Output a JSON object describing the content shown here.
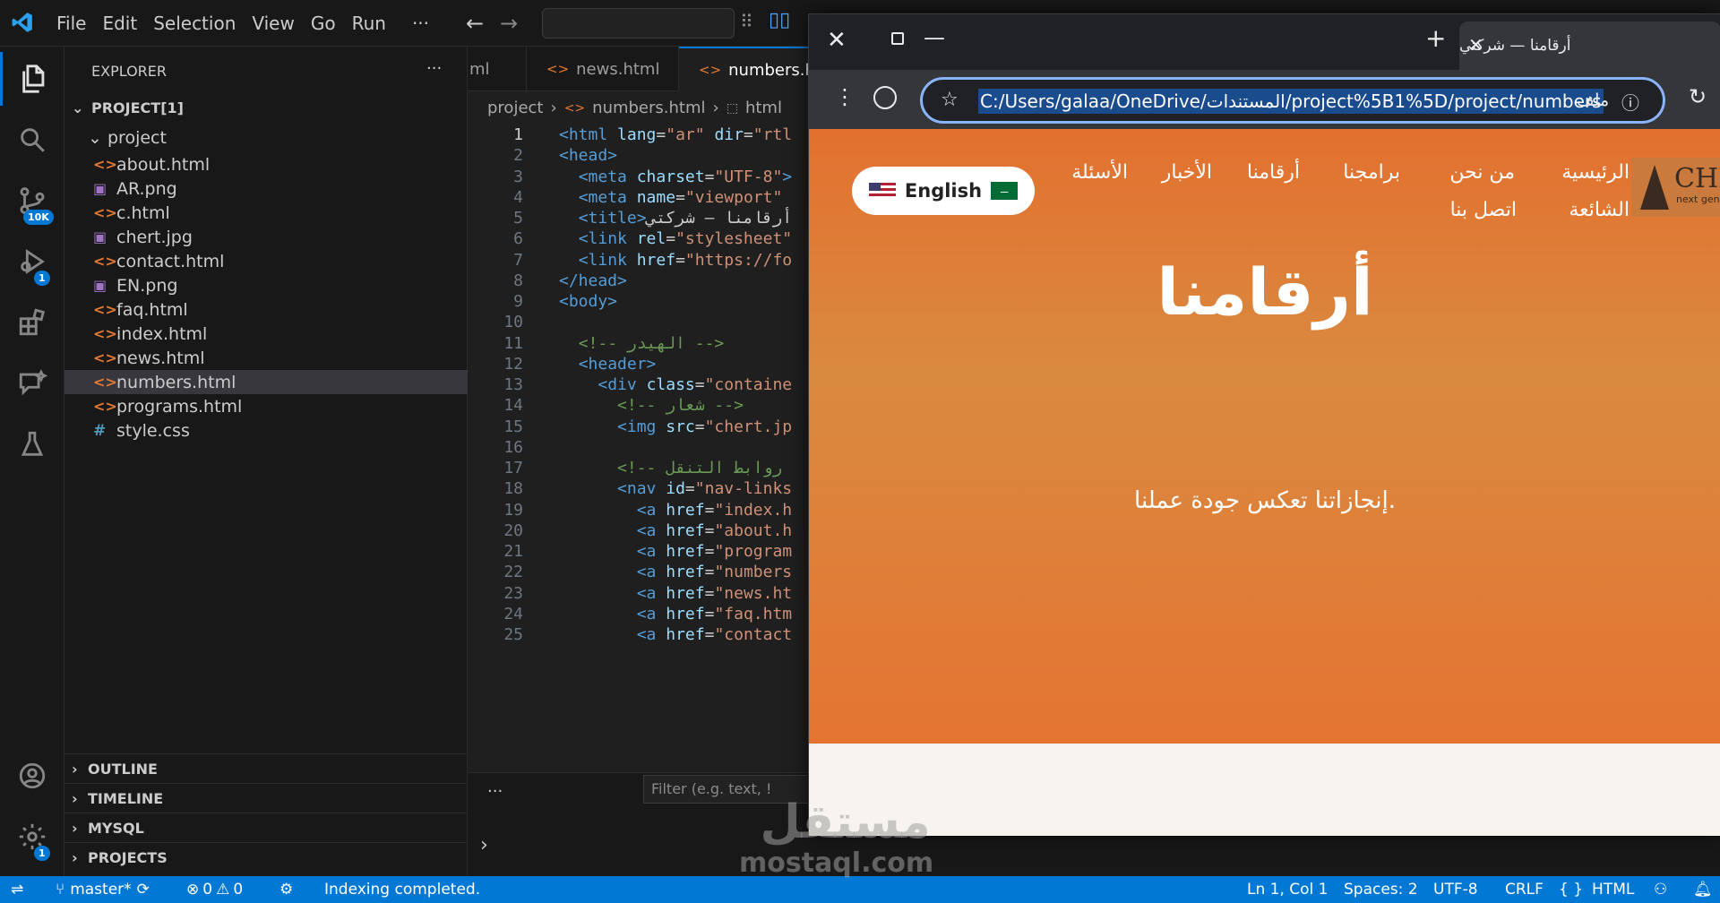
{
  "menu": [
    "File",
    "Edit",
    "Selection",
    "View",
    "Go",
    "Run",
    "···"
  ],
  "activity_badges": {
    "scm": "10K",
    "debug": "1",
    "settings": "1"
  },
  "explorer": {
    "title": "EXPLORER",
    "more": "···",
    "root": "PROJECT[1]",
    "folder": "project",
    "files": [
      {
        "name": "about.html",
        "type": "html"
      },
      {
        "name": "AR.png",
        "type": "img"
      },
      {
        "name": "c.html",
        "type": "html"
      },
      {
        "name": "chert.jpg",
        "type": "img"
      },
      {
        "name": "contact.html",
        "type": "html"
      },
      {
        "name": "EN.png",
        "type": "img"
      },
      {
        "name": "faq.html",
        "type": "html"
      },
      {
        "name": "index.html",
        "type": "html"
      },
      {
        "name": "news.html",
        "type": "html"
      },
      {
        "name": "numbers.html",
        "type": "html",
        "selected": true
      },
      {
        "name": "programs.html",
        "type": "html"
      },
      {
        "name": "style.css",
        "type": "css"
      }
    ],
    "sections": [
      "OUTLINE",
      "TIMELINE",
      "MYSQL",
      "PROJECTS"
    ]
  },
  "tabs": [
    "ml",
    "news.html",
    "numbers.h"
  ],
  "breadcrumb": [
    "project",
    "numbers.html",
    "html"
  ],
  "code_lines": [
    {
      "n": "1",
      "html": "<span class='t'>&lt;html</span> <span class='a'>lang</span>=<span class='s'>\"ar\"</span> <span class='a'>dir</span>=<span class='s'>\"rtl</span>"
    },
    {
      "n": "2",
      "html": "<span class='t'>&lt;head&gt;</span>"
    },
    {
      "n": "3",
      "html": "  <span class='t'>&lt;meta</span> <span class='a'>charset</span>=<span class='s'>\"UTF-8\"</span><span class='t'>&gt;</span>"
    },
    {
      "n": "4",
      "html": "  <span class='t'>&lt;meta</span> <span class='a'>name</span>=<span class='s'>\"viewport\"</span>"
    },
    {
      "n": "5",
      "html": "  <span class='t'>&lt;title&gt;</span>أرقامنا — شركتي"
    },
    {
      "n": "6",
      "html": "  <span class='t'>&lt;link</span> <span class='a'>rel</span>=<span class='s'>\"stylesheet\"</span>"
    },
    {
      "n": "7",
      "html": "  <span class='t'>&lt;link</span> <span class='a'>href</span>=<span class='s'>\"https://fo</span>"
    },
    {
      "n": "8",
      "html": "<span class='t'>&lt;/head&gt;</span>"
    },
    {
      "n": "9",
      "html": "<span class='t'>&lt;body&gt;</span>"
    },
    {
      "n": "10",
      "html": ""
    },
    {
      "n": "11",
      "html": "  <span class='c'>&lt;!-- الهيدر --&gt;</span>"
    },
    {
      "n": "12",
      "html": "  <span class='t'>&lt;header&gt;</span>"
    },
    {
      "n": "13",
      "html": "    <span class='t'>&lt;div</span> <span class='a'>class</span>=<span class='s'>\"containe</span>"
    },
    {
      "n": "14",
      "html": "      <span class='c'>&lt;!-- شعار --&gt;</span>"
    },
    {
      "n": "15",
      "html": "      <span class='t'>&lt;img</span> <span class='a'>src</span>=<span class='s'>\"chert.jp</span>"
    },
    {
      "n": "16",
      "html": ""
    },
    {
      "n": "17",
      "html": "      <span class='c'>&lt;!-- روابط التنقل</span>"
    },
    {
      "n": "18",
      "html": "      <span class='t'>&lt;nav</span> <span class='a'>id</span>=<span class='s'>\"nav-links</span>"
    },
    {
      "n": "19",
      "html": "        <span class='t'>&lt;a</span> <span class='a'>href</span>=<span class='s'>\"index.h</span>"
    },
    {
      "n": "20",
      "html": "        <span class='t'>&lt;a</span> <span class='a'>href</span>=<span class='s'>\"about.h</span>"
    },
    {
      "n": "21",
      "html": "        <span class='t'>&lt;a</span> <span class='a'>href</span>=<span class='s'>\"program</span>"
    },
    {
      "n": "22",
      "html": "        <span class='t'>&lt;a</span> <span class='a'>href</span>=<span class='s'>\"numbers</span>"
    },
    {
      "n": "23",
      "html": "        <span class='t'>&lt;a</span> <span class='a'>href</span>=<span class='s'>\"news.ht</span>"
    },
    {
      "n": "24",
      "html": "        <span class='t'>&lt;a</span> <span class='a'>href</span>=<span class='s'>\"faq.htm</span>"
    },
    {
      "n": "25",
      "html": "        <span class='t'>&lt;a</span> <span class='a'>href</span>=<span class='s'>\"contact</span>"
    }
  ],
  "panel": {
    "more": "···",
    "filter_placeholder": "Filter (e.g. text, !"
  },
  "status": {
    "branch": "master*",
    "errors": "0",
    "warnings": "0",
    "message": "Indexing completed.",
    "position": "Ln 1, Col 1",
    "spaces": "Spaces: 2",
    "encoding": "UTF-8",
    "eol": "CRLF",
    "language": "HTML",
    "braces": "{ }"
  },
  "browser": {
    "tab_title": "أرقامنا — شركتي",
    "url": "C:/Users/galaa/OneDrive/المستندات/project%5B1%5D/project/numbers",
    "file_label": "ملف",
    "nav": [
      "الرئيسية",
      "من نحن",
      "برامجنا",
      "أرقامنا",
      "الأخبار",
      "الأسئلة"
    ],
    "nav_row2": [
      "الشائعة",
      "اتصل بنا"
    ],
    "lang_button": "English",
    "logo_text": "CHE",
    "logo_sub": "next gen",
    "heading": "أرقامنا",
    "subheading": "إنجازاتنا تعكس جودة عملنا."
  },
  "watermark": {
    "line1": "مستقل",
    "line2": "mostaql.com"
  },
  "colors": {
    "accent": "#0078d4",
    "hero": "#e3702f",
    "url_highlight": "#1a4b8c"
  }
}
